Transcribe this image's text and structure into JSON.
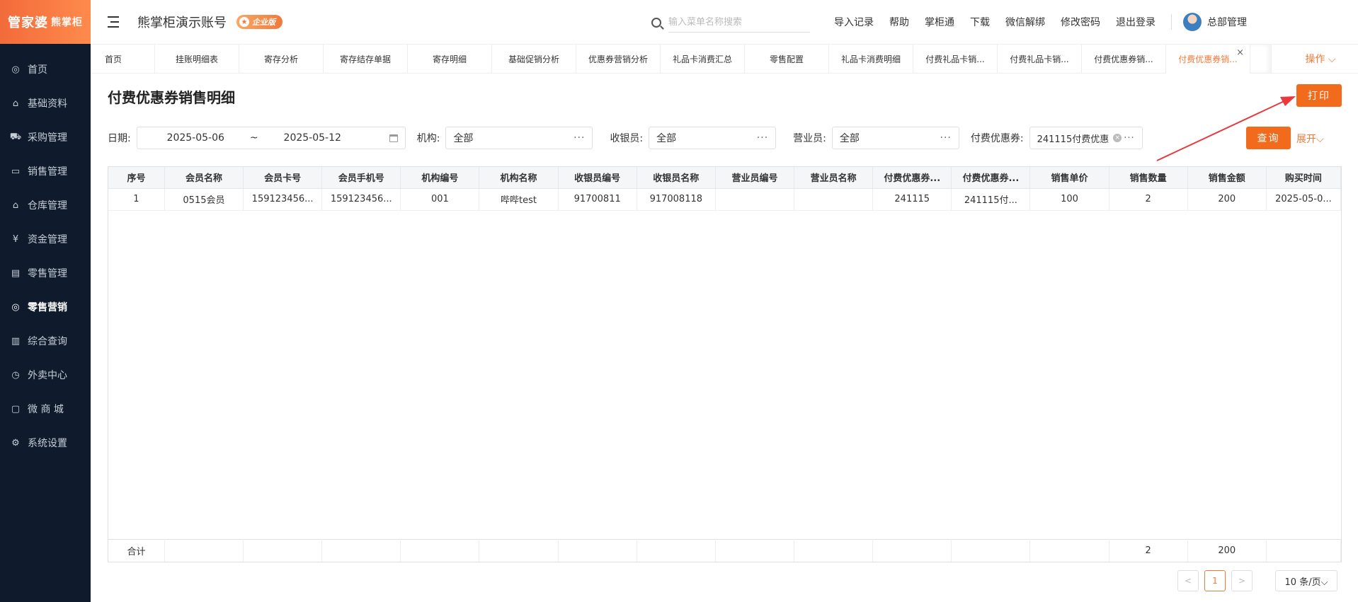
{
  "sidebar": {
    "logo_main": "管家婆",
    "logo_sub": "熊掌柜",
    "items": [
      {
        "label": "首页",
        "icon": "globe-icon",
        "glyph": "◎"
      },
      {
        "label": "基础资料",
        "icon": "home-icon",
        "glyph": "⌂"
      },
      {
        "label": "采购管理",
        "icon": "cart-icon",
        "glyph": "⛟"
      },
      {
        "label": "销售管理",
        "icon": "sales-icon",
        "glyph": "▭"
      },
      {
        "label": "仓库管理",
        "icon": "warehouse-icon",
        "glyph": "⌂"
      },
      {
        "label": "资金管理",
        "icon": "finance-icon",
        "glyph": "¥"
      },
      {
        "label": "零售管理",
        "icon": "chart-icon",
        "glyph": "▤"
      },
      {
        "label": "零售营销",
        "icon": "globe-icon",
        "glyph": "◎"
      },
      {
        "label": "综合查询",
        "icon": "bar-chart-icon",
        "glyph": "▥"
      },
      {
        "label": "外卖中心",
        "icon": "alarm-icon",
        "glyph": "◷"
      },
      {
        "label": "微 商 城",
        "icon": "shop-icon",
        "glyph": "▢"
      },
      {
        "label": "系统设置",
        "icon": "gear-icon",
        "glyph": "⚙"
      }
    ],
    "active_index": 7
  },
  "header": {
    "account_title": "熊掌柜演示账号",
    "badge": "企业版",
    "search_placeholder": "输入菜单名称搜索",
    "links": [
      "导入记录",
      "帮助",
      "掌柜通",
      "下载",
      "微信解绑",
      "修改密码",
      "退出登录"
    ],
    "user_name": "总部管理"
  },
  "tabs": {
    "items": [
      "首页",
      "挂账明细表",
      "寄存分析",
      "寄存结存单据",
      "寄存明细",
      "基础促销分析",
      "优惠券营销分析",
      "礼品卡消费汇总",
      "零售配置",
      "礼品卡消费明细",
      "付费礼品卡销...",
      "付费礼品卡销...",
      "付费优惠券销...",
      "付费优惠券销..."
    ],
    "active_index": 13,
    "close": "×",
    "ops_label": "操作 ⌵"
  },
  "page": {
    "title": "付费优惠券销售明细",
    "print_label": "打印",
    "query_label": "查询",
    "expand_label": "展开⌵"
  },
  "filters": {
    "date_label": "日期:",
    "date_start": "2025-05-06",
    "date_sep": "~",
    "date_end": "2025-05-12",
    "org_label": "机构:",
    "org_value": "全部",
    "cashier_label": "收银员:",
    "cashier_value": "全部",
    "clerk_label": "营业员:",
    "clerk_value": "全部",
    "coupon_label": "付费优惠券:",
    "coupon_value": "241115付费优惠",
    "dots": "···"
  },
  "table": {
    "columns": [
      "序号",
      "会员名称",
      "会员卡号",
      "会员手机号",
      "机构编号",
      "机构名称",
      "收银员编号",
      "收银员名称",
      "营业员编号",
      "营业员名称",
      "付费优惠券...",
      "付费优惠券...",
      "销售单价",
      "销售数量",
      "销售金额",
      "购买时间"
    ],
    "rows": [
      [
        "1",
        "0515会员",
        "159123456...",
        "159123456...",
        "001",
        "哔哔test",
        "91700811",
        "917008118",
        "",
        "",
        "241115",
        "241115付...",
        "100",
        "2",
        "200",
        "2025-05-0..."
      ]
    ],
    "totals": [
      "合计",
      "",
      "",
      "",
      "",
      "",
      "",
      "",
      "",
      "",
      "",
      "",
      "",
      "2",
      "200",
      ""
    ]
  },
  "pagination": {
    "prev": "<",
    "current": "1",
    "next": ">",
    "page_size": "10 条/页⌵"
  },
  "colors": {
    "accent": "#f26b1d",
    "sidebar_bg": "#0f1b2d",
    "annotation_arrow": "#e8393d"
  }
}
